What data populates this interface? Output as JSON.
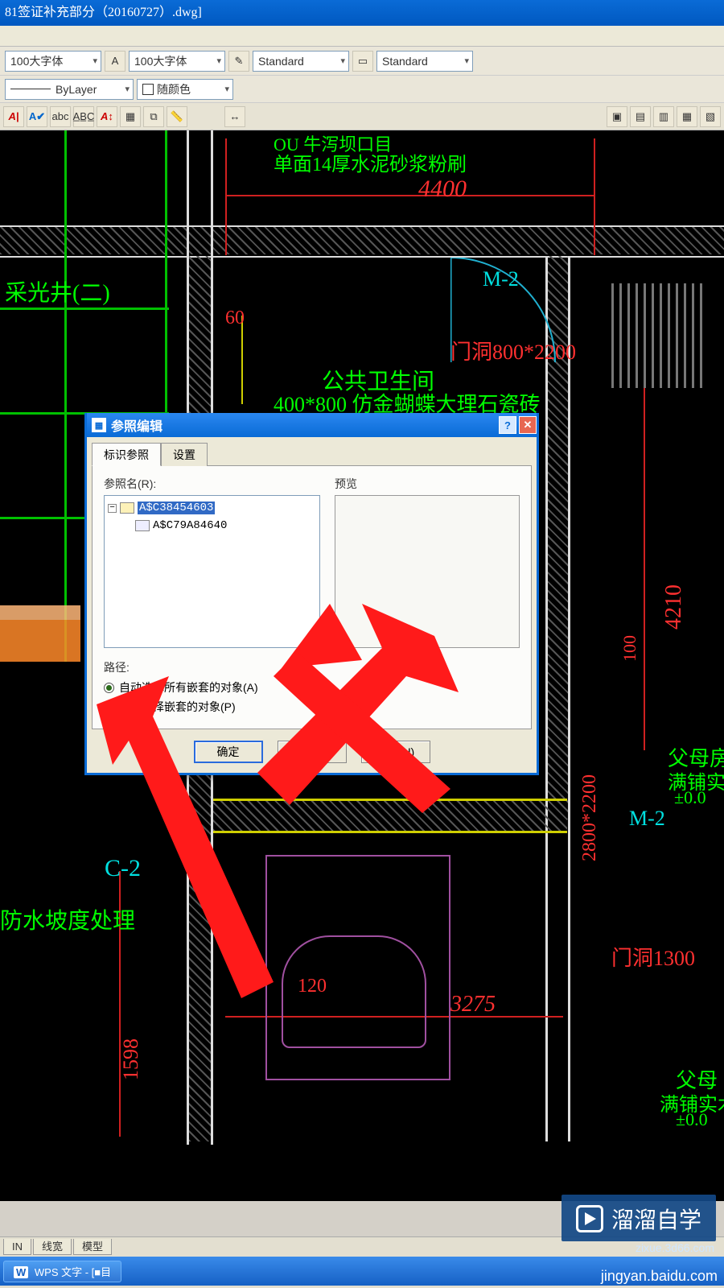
{
  "window": {
    "title": "81签证补充部分（20160727）.dwg]"
  },
  "toolbar": {
    "font_style_1": "100大字体",
    "font_style_2": "100大字体",
    "dim_style": "Standard",
    "dim_style_2": "Standard",
    "layer_line": "ByLayer",
    "color_name": "随颜色"
  },
  "canvas": {
    "annot_top1": "OU 牛泻坝口目",
    "annot_top2": "单面14厚水泥砂浆粉刷",
    "dim_4400": "4400",
    "room_left": "采光井(二)",
    "mark_m2": "M-2",
    "mark_m2b": "M-2",
    "dim_60": "60",
    "door_800": "门洞800*2200",
    "room_toilet_1": "公共卫生间",
    "room_toilet_2": "400*800 仿金蝴蝶大理石瓷砖",
    "dim_4210": "4210",
    "dim_100": "100",
    "dim_2800": "2800*2200",
    "room_right1": "父母房",
    "room_right2": "满铺实",
    "room_right3": "±0.0",
    "room_right1b": "父母",
    "room_right2b": "满铺实木",
    "room_right3b": "±0.0",
    "mark_c2": "C-2",
    "annot_slope": "防水坡度处理",
    "dim_1598": "1598",
    "dim_120": "120",
    "door_1300": "门洞1300",
    "dim_3275": "3275"
  },
  "dialog": {
    "title": "参照编辑",
    "tab1": "标识参照",
    "tab2": "设置",
    "ref_name_label": "参照名(R):",
    "preview_label": "预览",
    "node1": "A$C38454603",
    "node2": "A$C79A84640",
    "path_label": "路径:",
    "radio1": "自动选择所有嵌套的对象(A)",
    "radio2": "提示选择嵌套的对象(P)",
    "ok": "确定",
    "cancel": "取消",
    "help": "帮助(H)"
  },
  "status": {
    "tab_a": "IN",
    "tab_b": "线宽",
    "tab_c": "模型"
  },
  "taskbar": {
    "item1": "WPS 文字 - [■目"
  },
  "watermark": {
    "brand": "溜溜自学",
    "sub": "zixue.3d66.com",
    "credit": "jingyan.baidu.com"
  }
}
